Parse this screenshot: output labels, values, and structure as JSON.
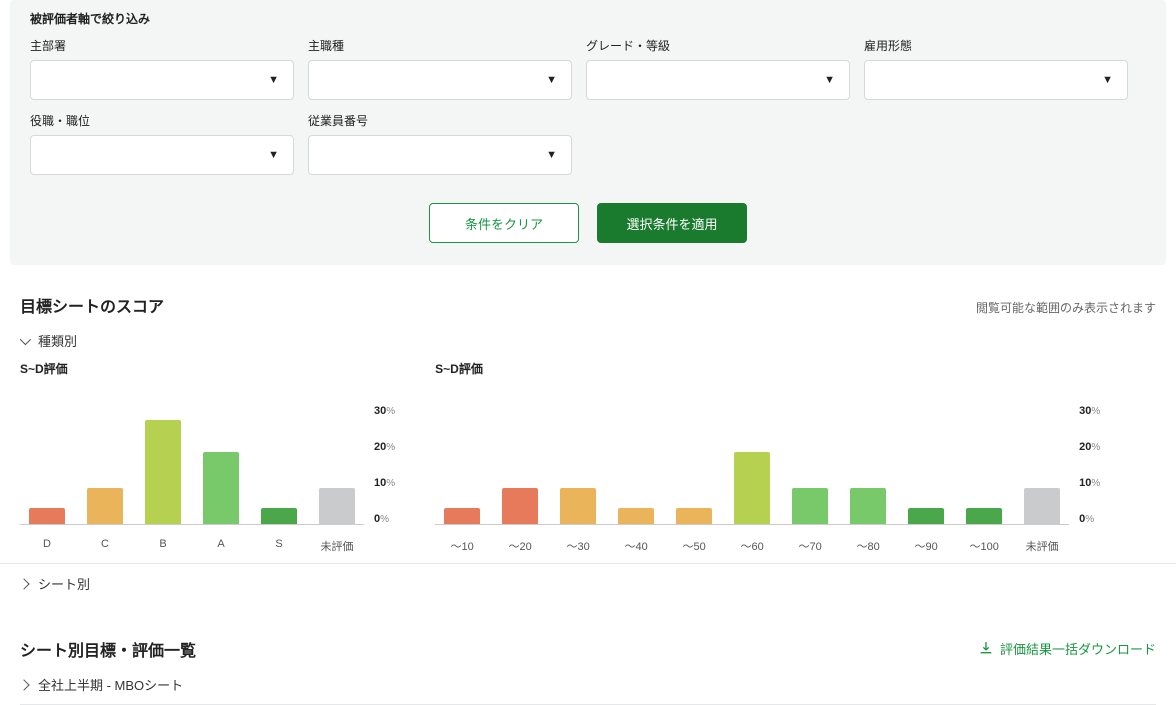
{
  "filter": {
    "title": "被評価者軸で絞り込み",
    "fields": {
      "dept": {
        "label": "主部署"
      },
      "job": {
        "label": "主職種"
      },
      "grade": {
        "label": "グレード・等級"
      },
      "emp": {
        "label": "雇用形態"
      },
      "rank": {
        "label": "役職・職位"
      },
      "empno": {
        "label": "従業員番号"
      }
    },
    "clear_btn": "条件をクリア",
    "apply_btn": "選択条件を適用"
  },
  "score_section": {
    "title": "目標シートのスコア",
    "note": "閲覧可能な範囲のみ表示されます",
    "by_type": "種類別",
    "by_sheet": "シート別"
  },
  "sheet_section": {
    "title": "シート別目標・評価一覧",
    "download": "評価結果一括ダウンロード",
    "item0": "全社上半期 - MBOシート"
  },
  "chart_data": [
    {
      "type": "bar",
      "title": "S~D評価",
      "ylabel": "%",
      "ylim": [
        0,
        30
      ],
      "yticks": [
        0,
        10,
        20,
        30
      ],
      "categories": [
        "D",
        "C",
        "B",
        "A",
        "S",
        "未評価"
      ],
      "values": [
        4,
        9,
        26,
        18,
        4,
        9
      ],
      "colors": [
        "c-red",
        "c-orange",
        "c-yelgr",
        "c-green",
        "c-dgreen",
        "c-gray"
      ]
    },
    {
      "type": "bar",
      "title": "S~D評価",
      "ylabel": "%",
      "ylim": [
        0,
        30
      ],
      "yticks": [
        0,
        10,
        20,
        30
      ],
      "categories": [
        "〜10",
        "〜20",
        "〜30",
        "〜40",
        "〜50",
        "〜60",
        "〜70",
        "〜80",
        "〜90",
        "〜100",
        "未評価"
      ],
      "values": [
        4,
        9,
        9,
        4,
        4,
        18,
        9,
        9,
        4,
        4,
        9
      ],
      "colors": [
        "c-red",
        "c-red",
        "c-orange",
        "c-orange",
        "c-orange",
        "c-yelgr",
        "c-green",
        "c-green",
        "c-dgreen",
        "c-dgreen",
        "c-gray"
      ]
    }
  ]
}
